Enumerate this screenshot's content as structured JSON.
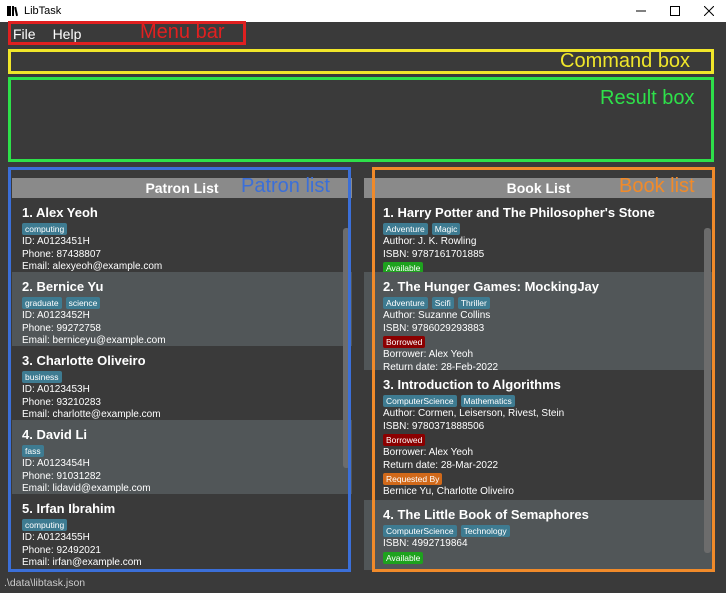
{
  "window": {
    "title": "LibTask"
  },
  "menu": {
    "items": [
      "File",
      "Help"
    ]
  },
  "command": {
    "value": ""
  },
  "annotations": {
    "menu_bar": "Menu bar",
    "command_box": "Command box",
    "result_box": "Result box",
    "patron_list": "Patron list",
    "book_list": "Book list"
  },
  "colors": {
    "menu_bar": "#e02020",
    "command_box": "#f0e62a",
    "result_box": "#2ee04a",
    "patron_list": "#3b6fd8",
    "book_list": "#f08a2a"
  },
  "patrons": {
    "header": "Patron List",
    "items": [
      {
        "title": "1.  Alex Yeoh",
        "tags": [
          "computing"
        ],
        "id": "ID: A0123451H",
        "phone": "Phone: 87438807",
        "email": "Email: alexyeoh@example.com"
      },
      {
        "title": "2.  Bernice Yu",
        "tags": [
          "graduate",
          "science"
        ],
        "id": "ID: A0123452H",
        "phone": "Phone: 99272758",
        "email": "Email: berniceyu@example.com"
      },
      {
        "title": "3.  Charlotte Oliveiro",
        "tags": [
          "business"
        ],
        "id": "ID: A0123453H",
        "phone": "Phone: 93210283",
        "email": "Email: charlotte@example.com"
      },
      {
        "title": "4.  David Li",
        "tags": [
          "fass"
        ],
        "id": "ID: A0123454H",
        "phone": "Phone: 91031282",
        "email": "Email: lidavid@example.com"
      },
      {
        "title": "5.  Irfan Ibrahim",
        "tags": [
          "computing"
        ],
        "id": "ID: A0123455H",
        "phone": "Phone: 92492021",
        "email": "Email: irfan@example.com"
      }
    ]
  },
  "books": {
    "header": "Book List",
    "items": [
      {
        "title": "1.  Harry Potter and The Philosopher's Stone",
        "tags": [
          "Adventure",
          "Magic"
        ],
        "author": "Author: J. K. Rowling",
        "isbn": "ISBN: 9787161701885",
        "status": "Available"
      },
      {
        "title": "2.  The Hunger Games: MockingJay",
        "tags": [
          "Adventure",
          "Scifi",
          "Thriller"
        ],
        "author": "Author: Suzanne Collins",
        "isbn": "ISBN: 9786029293883",
        "status": "Borrowed",
        "borrower": "Borrower: Alex Yeoh",
        "return_date": "Return date: 28-Feb-2022"
      },
      {
        "title": "3.  Introduction to Algorithms",
        "tags": [
          "ComputerScience",
          "Mathematics"
        ],
        "author": "Author: Cormen, Leiserson, Rivest, Stein",
        "isbn": "ISBN: 9780371888506",
        "status": "Borrowed",
        "borrower": "Borrower: Alex Yeoh",
        "return_date": "Return date: 28-Mar-2022",
        "requested_label": "Requested By",
        "requested_by": "Bernice Yu, Charlotte Oliveiro"
      },
      {
        "title": "4.  The Little Book of Semaphores",
        "tags": [
          "ComputerScience",
          "Technology"
        ],
        "isbn": "ISBN: 4992719864",
        "status": "Available"
      }
    ]
  },
  "status_bar": {
    "path": ".\\data\\libtask.json"
  }
}
